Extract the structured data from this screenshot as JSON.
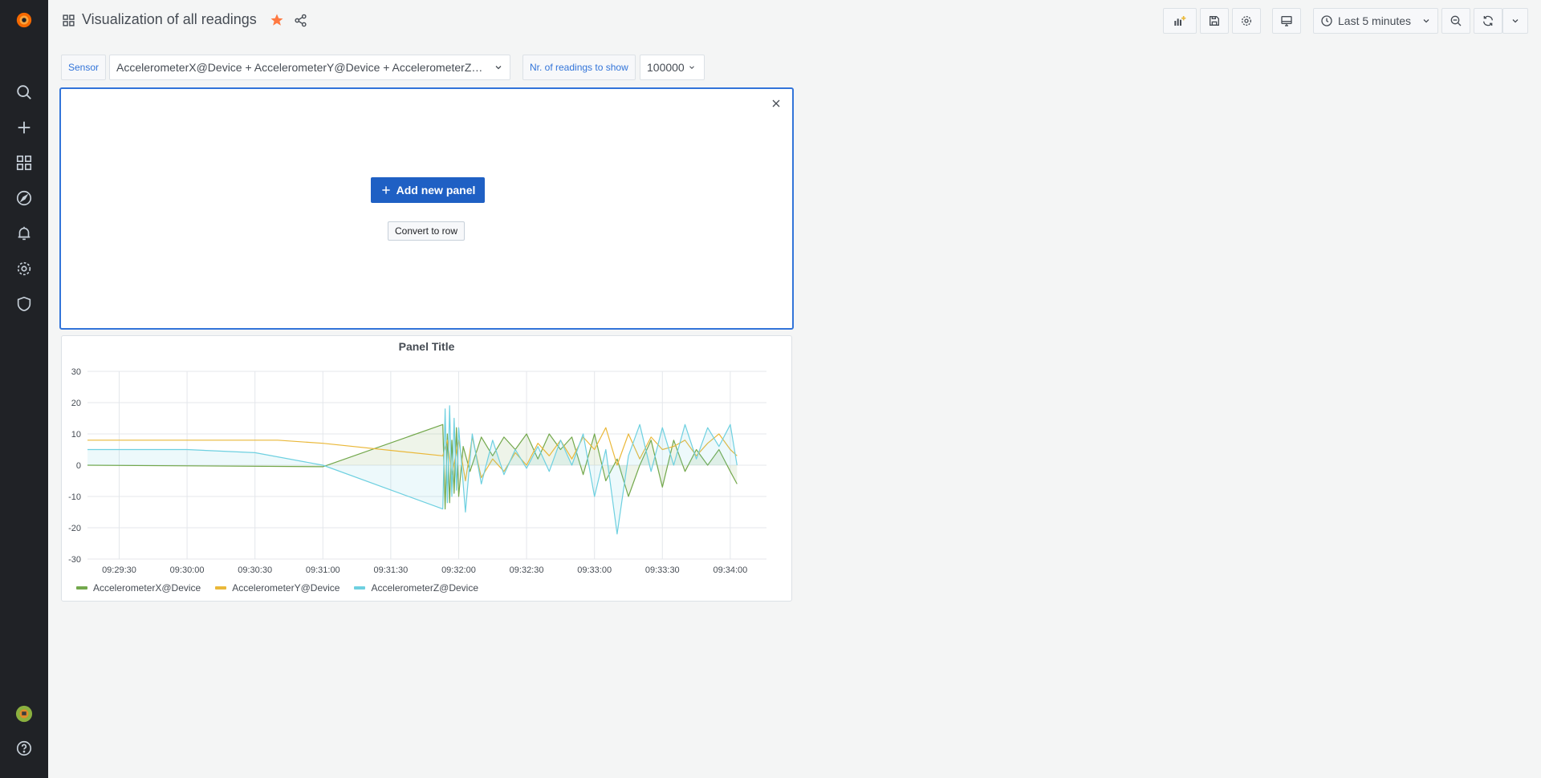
{
  "header": {
    "title": "Visualization of all readings",
    "time_range": "Last 5 minutes"
  },
  "variables": {
    "sensor_label": "Sensor",
    "sensor_value": "AccelerometerX@Device + AccelerometerY@Device + AccelerometerZ@...",
    "readings_label": "Nr. of readings to show",
    "readings_value": "100000"
  },
  "add_panel": {
    "add_label": "Add new panel",
    "convert_label": "Convert to row"
  },
  "colors": {
    "accent": "#3274d9",
    "primary_button": "#1f60c4",
    "star": "#ff7941",
    "sidebar": "#202226",
    "series_x": "#73a84c",
    "series_y": "#eab839",
    "series_z": "#6ed0e0"
  },
  "icons": {
    "sidebar": [
      "grafana-logo-icon",
      "search-icon",
      "plus-icon",
      "dashboards-icon",
      "explore-icon",
      "alerting-icon",
      "configuration-icon",
      "shield-icon",
      "avatar-icon",
      "help-icon"
    ],
    "toolbar": [
      "add-panel-icon",
      "save-icon",
      "settings-icon",
      "tv-mode-icon",
      "clock-icon",
      "zoom-out-icon",
      "refresh-icon",
      "chevron-down-icon"
    ]
  },
  "chart_data": {
    "type": "line",
    "title": "Panel Title",
    "xlabel": "",
    "ylabel": "",
    "ylim": [
      -30,
      30
    ],
    "yticks": [
      30,
      20,
      10,
      0,
      -10,
      -20,
      -30
    ],
    "xticks": [
      "09:29:30",
      "09:30:00",
      "09:30:30",
      "09:31:00",
      "09:31:30",
      "09:32:00",
      "09:32:30",
      "09:33:00",
      "09:33:30",
      "09:34:00"
    ],
    "xlim": [
      "09:29:16",
      "09:34:16"
    ],
    "grid": true,
    "legend_position": "bottom-left",
    "series": [
      {
        "name": "AccelerometerX@Device",
        "color": "#73a84c",
        "fill": true,
        "points": [
          [
            "09:29:16",
            0
          ],
          [
            "09:31:00",
            -0.5
          ],
          [
            "09:31:53",
            13
          ],
          [
            "09:31:54",
            -14
          ],
          [
            "09:31:55",
            10
          ],
          [
            "09:31:56",
            -12
          ],
          [
            "09:31:57",
            8
          ],
          [
            "09:31:58",
            -9
          ],
          [
            "09:31:59",
            12
          ],
          [
            "09:32:00",
            -10
          ],
          [
            "09:32:02",
            6
          ],
          [
            "09:32:05",
            -2
          ],
          [
            "09:32:10",
            9
          ],
          [
            "09:32:15",
            3
          ],
          [
            "09:32:20",
            9
          ],
          [
            "09:32:25",
            5
          ],
          [
            "09:32:30",
            10
          ],
          [
            "09:32:35",
            2
          ],
          [
            "09:32:40",
            10
          ],
          [
            "09:32:45",
            5
          ],
          [
            "09:32:50",
            9
          ],
          [
            "09:32:55",
            -3
          ],
          [
            "09:33:00",
            10
          ],
          [
            "09:33:05",
            -5
          ],
          [
            "09:33:10",
            2
          ],
          [
            "09:33:15",
            -10
          ],
          [
            "09:33:20",
            0
          ],
          [
            "09:33:25",
            8
          ],
          [
            "09:33:30",
            -7
          ],
          [
            "09:33:35",
            8
          ],
          [
            "09:33:40",
            -2
          ],
          [
            "09:33:45",
            5
          ],
          [
            "09:33:50",
            0
          ],
          [
            "09:33:55",
            5
          ],
          [
            "09:34:00",
            -2
          ],
          [
            "09:34:03",
            -6
          ]
        ]
      },
      {
        "name": "AccelerometerY@Device",
        "color": "#eab839",
        "fill": false,
        "points": [
          [
            "09:29:16",
            8
          ],
          [
            "09:30:40",
            8
          ],
          [
            "09:31:00",
            7
          ],
          [
            "09:31:53",
            3
          ],
          [
            "09:31:55",
            8
          ],
          [
            "09:31:57",
            -3
          ],
          [
            "09:32:00",
            8
          ],
          [
            "09:32:03",
            -5
          ],
          [
            "09:32:06",
            9
          ],
          [
            "09:32:10",
            -4
          ],
          [
            "09:32:15",
            2
          ],
          [
            "09:32:20",
            -2
          ],
          [
            "09:32:25",
            4
          ],
          [
            "09:32:30",
            0
          ],
          [
            "09:32:35",
            7
          ],
          [
            "09:32:40",
            3
          ],
          [
            "09:32:45",
            8
          ],
          [
            "09:32:50",
            2
          ],
          [
            "09:32:55",
            9
          ],
          [
            "09:33:00",
            5
          ],
          [
            "09:33:05",
            12
          ],
          [
            "09:33:10",
            0
          ],
          [
            "09:33:15",
            10
          ],
          [
            "09:33:20",
            2
          ],
          [
            "09:33:25",
            9
          ],
          [
            "09:33:30",
            5
          ],
          [
            "09:33:35",
            6
          ],
          [
            "09:33:40",
            8
          ],
          [
            "09:33:45",
            3
          ],
          [
            "09:33:50",
            7
          ],
          [
            "09:33:55",
            10
          ],
          [
            "09:34:00",
            5
          ],
          [
            "09:34:03",
            3
          ]
        ]
      },
      {
        "name": "AccelerometerZ@Device",
        "color": "#6ed0e0",
        "fill": true,
        "points": [
          [
            "09:29:16",
            5
          ],
          [
            "09:30:00",
            5
          ],
          [
            "09:30:30",
            4
          ],
          [
            "09:31:00",
            0
          ],
          [
            "09:31:53",
            -14
          ],
          [
            "09:31:54",
            18
          ],
          [
            "09:31:55",
            -12
          ],
          [
            "09:31:56",
            19
          ],
          [
            "09:31:57",
            -10
          ],
          [
            "09:31:58",
            15
          ],
          [
            "09:31:59",
            -8
          ],
          [
            "09:32:00",
            12
          ],
          [
            "09:32:03",
            -15
          ],
          [
            "09:32:06",
            10
          ],
          [
            "09:32:10",
            -6
          ],
          [
            "09:32:15",
            8
          ],
          [
            "09:32:20",
            -3
          ],
          [
            "09:32:25",
            5
          ],
          [
            "09:32:30",
            -1
          ],
          [
            "09:32:35",
            6
          ],
          [
            "09:32:40",
            -2
          ],
          [
            "09:32:45",
            8
          ],
          [
            "09:32:50",
            0
          ],
          [
            "09:32:55",
            10
          ],
          [
            "09:33:00",
            -10
          ],
          [
            "09:33:05",
            5
          ],
          [
            "09:33:10",
            -22
          ],
          [
            "09:33:15",
            3
          ],
          [
            "09:33:20",
            13
          ],
          [
            "09:33:25",
            -2
          ],
          [
            "09:33:30",
            12
          ],
          [
            "09:33:35",
            0
          ],
          [
            "09:33:40",
            13
          ],
          [
            "09:33:45",
            2
          ],
          [
            "09:33:50",
            12
          ],
          [
            "09:33:55",
            6
          ],
          [
            "09:34:00",
            13
          ],
          [
            "09:34:03",
            0
          ]
        ]
      }
    ]
  }
}
